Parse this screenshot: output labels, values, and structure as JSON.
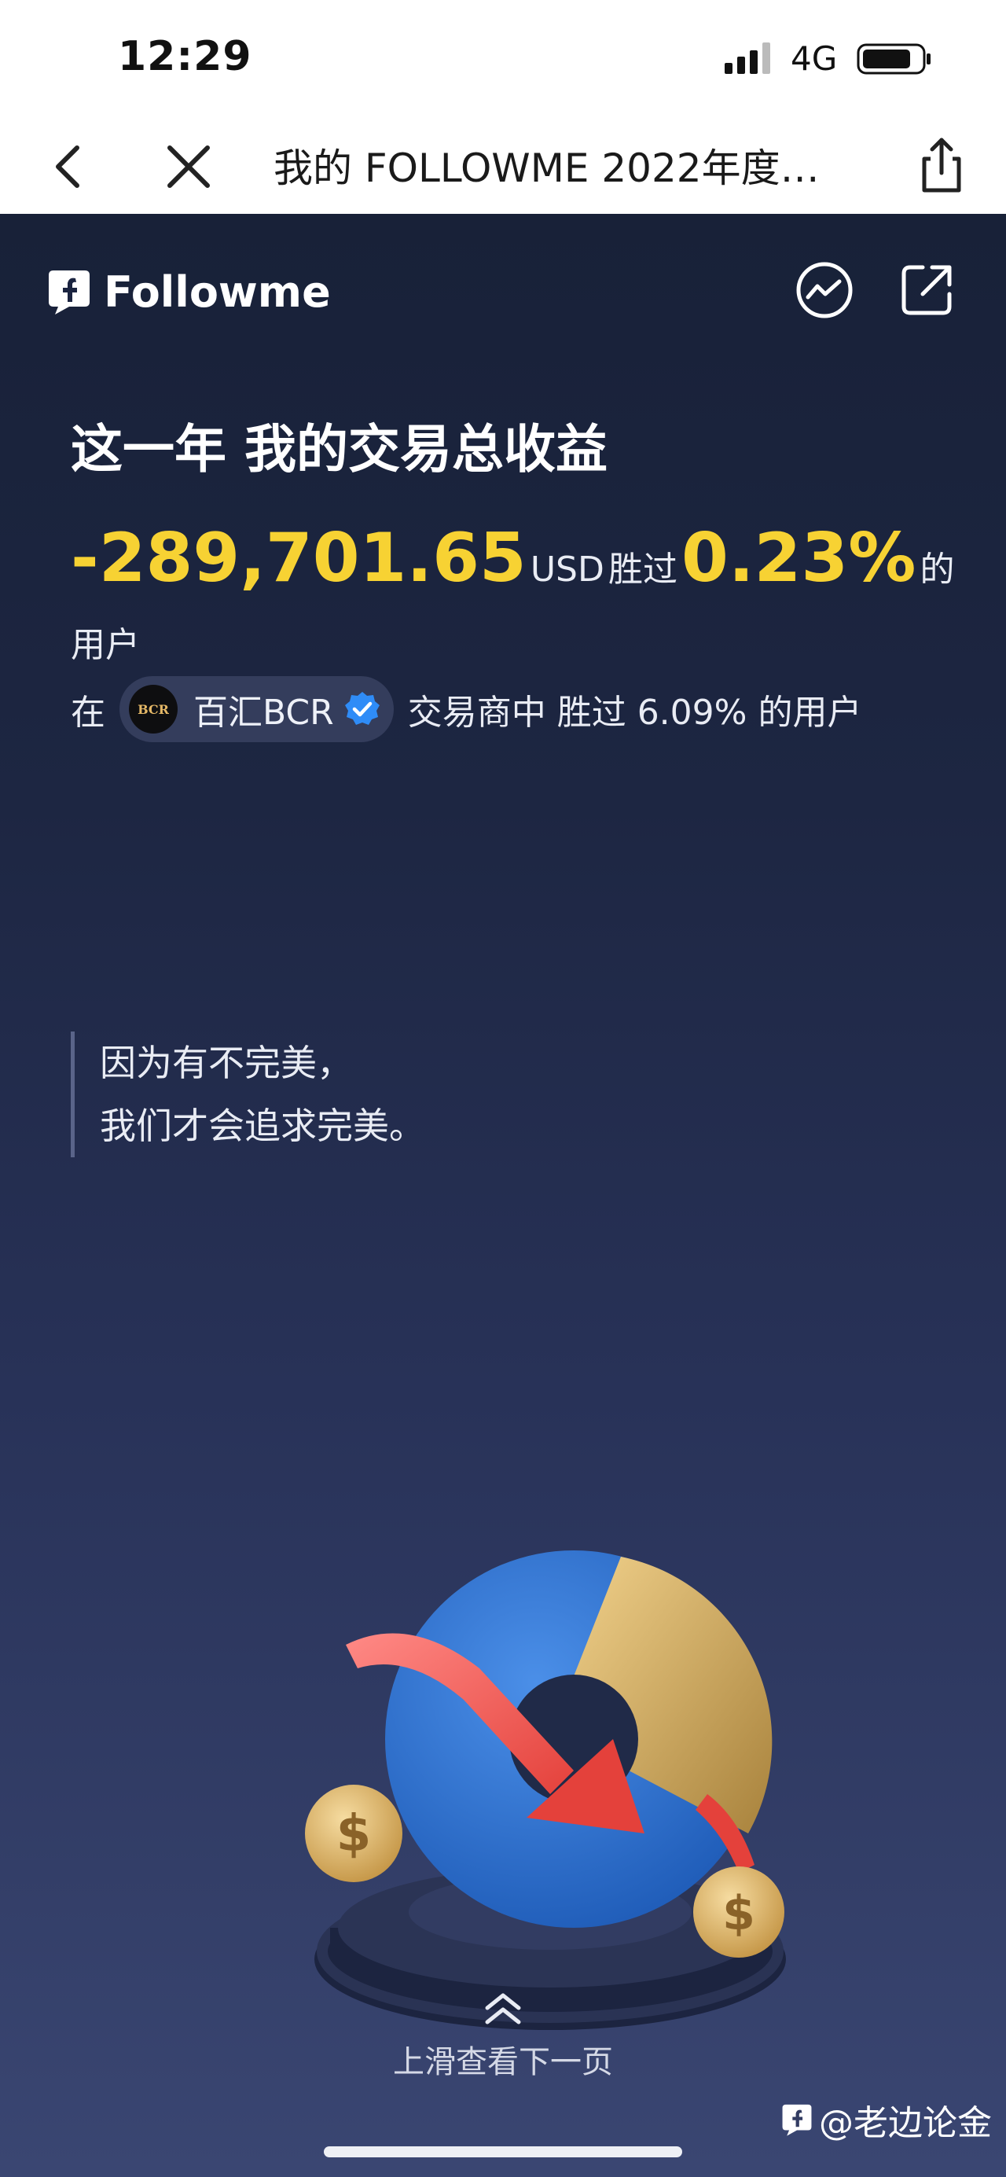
{
  "status_bar": {
    "time": "12:29",
    "network": "4G"
  },
  "nav": {
    "title": "我的 FOLLOWME 2022年度…",
    "back_icon": "chevron-left-icon",
    "close_icon": "close-icon",
    "share_icon": "share-icon"
  },
  "brand": {
    "name": "Followme"
  },
  "heading": "这一年 我的交易总收益",
  "stats": {
    "profit": "-289,701.65",
    "currency": "USD",
    "beat_label": "胜过",
    "beat_percent": "0.23%",
    "suffix": "的",
    "users": "用户"
  },
  "broker": {
    "prefix": "在",
    "logo_text": "BCR",
    "name": "百汇BCR",
    "suffix": "交易商中 胜过 6.09% 的用户"
  },
  "quote": {
    "line1": "因为有不完美，",
    "line2": "我们才会追求完美。"
  },
  "swipe_hint": "上滑查看下一页",
  "watermark": "@老边论金",
  "colors": {
    "accent_yellow": "#f7d233",
    "background_top": "#182138",
    "background_bottom": "#3a4672"
  }
}
